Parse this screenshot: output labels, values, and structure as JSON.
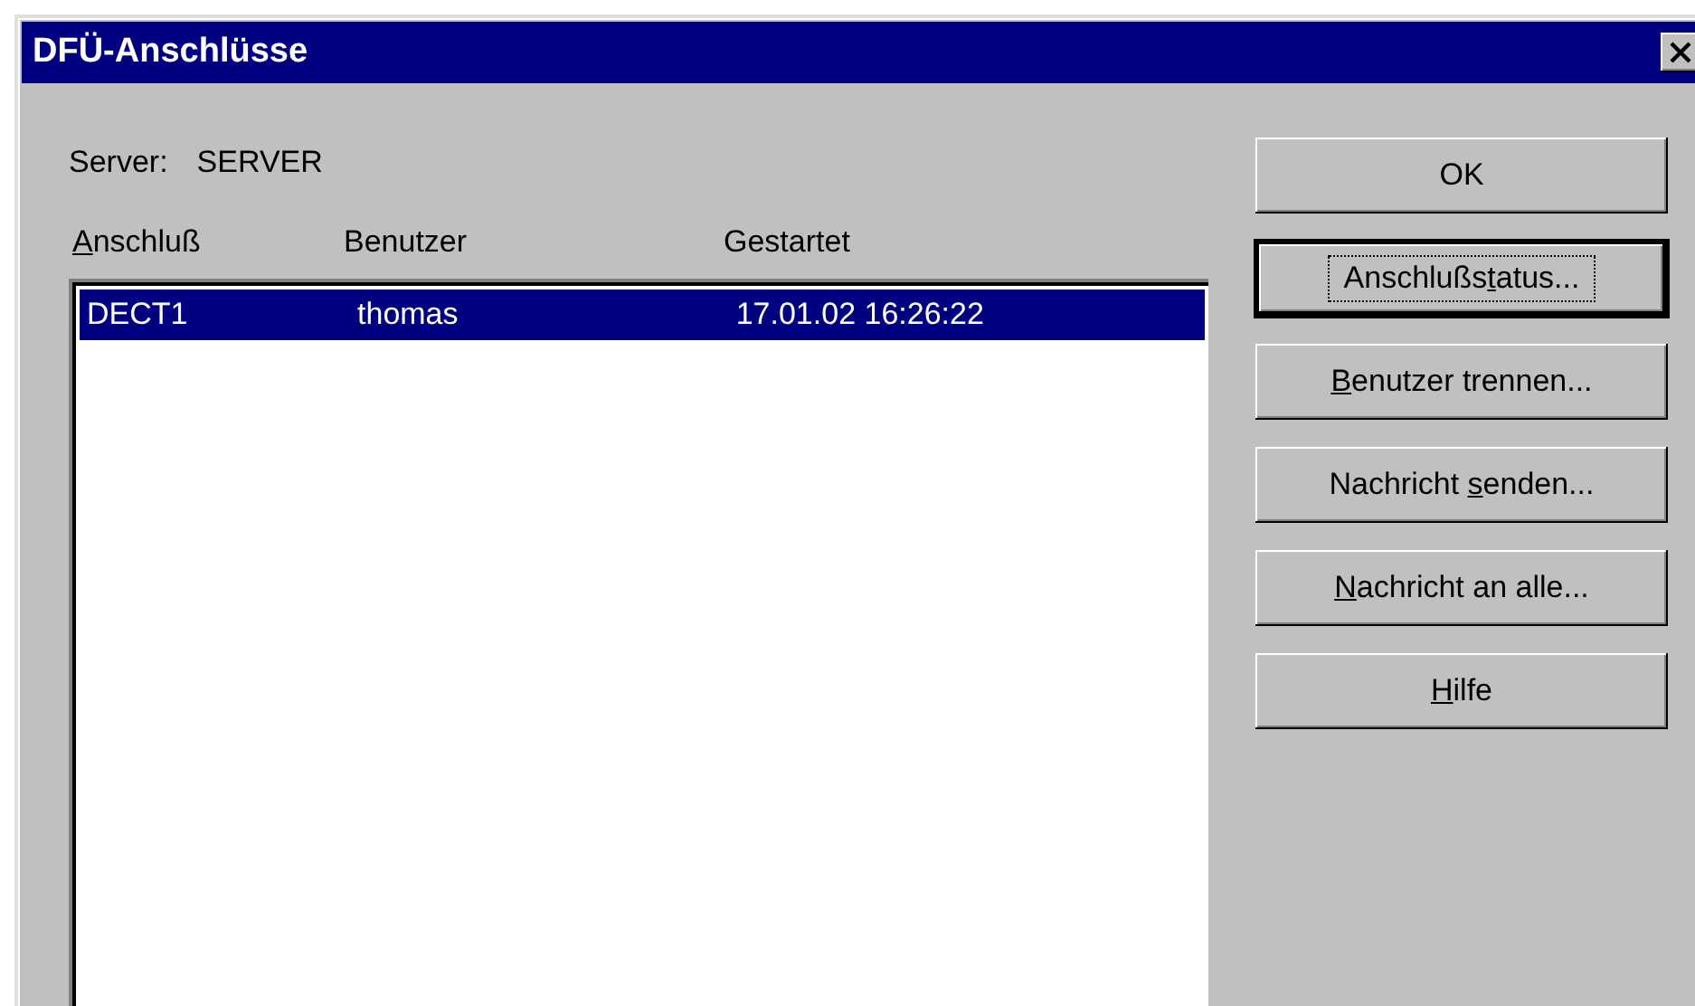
{
  "window": {
    "title": "DFÜ-Anschlüsse"
  },
  "server": {
    "label": "Server:",
    "value": "SERVER"
  },
  "list": {
    "columns": [
      {
        "key": "A",
        "after": "nschluß"
      },
      {
        "before": "Benutzer"
      },
      {
        "before": "Gestartet"
      }
    ],
    "rows": [
      {
        "cells": [
          "DECT1",
          "thomas",
          "17.01.02 16:26:22"
        ],
        "selected": true
      }
    ]
  },
  "buttons": [
    {
      "before": "OK",
      "focused": false
    },
    {
      "before": "Anschlußs",
      "key": "t",
      "after": "atus...",
      "focused": true
    },
    {
      "key": "B",
      "after": "enutzer trennen...",
      "focused": false
    },
    {
      "before": "Nachricht ",
      "key": "s",
      "after": "enden...",
      "focused": false
    },
    {
      "key": "N",
      "after": "achricht an alle...",
      "focused": false
    },
    {
      "key": "H",
      "after": "ilfe",
      "focused": false
    }
  ]
}
